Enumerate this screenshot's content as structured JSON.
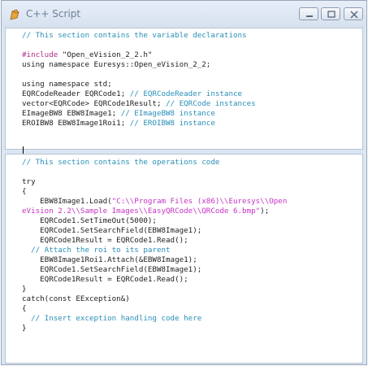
{
  "window": {
    "title": "C++ Script",
    "icon": "cpp-script-icon",
    "controls": [
      "minimize-icon",
      "maximize-icon",
      "close-icon"
    ]
  },
  "colors": {
    "comment": "#2a8fb8",
    "string": "#c534c5",
    "preprocessor": "#b02c8a",
    "text": "#222222"
  },
  "declarations": {
    "lines": [
      [
        {
          "t": "// This section contains the variable declarations",
          "c": "cmt"
        }
      ],
      [],
      [
        {
          "t": "#include ",
          "c": "pp"
        },
        {
          "t": "\"Open_eVision_2_2.h\"",
          "c": ""
        }
      ],
      [
        {
          "t": "using namespace Euresys::Open_eVision_2_2;",
          "c": ""
        }
      ],
      [],
      [
        {
          "t": "using namespace std;",
          "c": ""
        }
      ],
      [
        {
          "t": "EQRCodeReader EQRCode1; ",
          "c": ""
        },
        {
          "t": "// EQRCodeReader instance",
          "c": "cmt"
        }
      ],
      [
        {
          "t": "vector<EQRCode> EQRCode1Result; ",
          "c": ""
        },
        {
          "t": "// EQRCode instances",
          "c": "cmt"
        }
      ],
      [
        {
          "t": "EImageBW8 EBW8Image1; ",
          "c": ""
        },
        {
          "t": "// EImageBW8 instance",
          "c": "cmt"
        }
      ],
      [
        {
          "t": "EROIBW8 EBW8Image1Roi1; ",
          "c": ""
        },
        {
          "t": "// EROIBW8 instance",
          "c": "cmt"
        }
      ]
    ]
  },
  "operations": {
    "lines": [
      [
        {
          "t": "// This section contains the operations code",
          "c": "cmt"
        }
      ],
      [],
      [
        {
          "t": "try",
          "c": ""
        }
      ],
      [
        {
          "t": "{",
          "c": ""
        }
      ],
      [
        {
          "t": "    EBW8Image1.Load(",
          "c": ""
        },
        {
          "t": "\"C:\\\\Program Files (x86)\\\\Euresys\\\\Open",
          "c": "str"
        }
      ],
      [
        {
          "t": "eVision 2.2\\\\Sample Images\\\\EasyQRCode\\\\QRCode 6.bmp\"",
          "c": "str"
        },
        {
          "t": ");",
          "c": ""
        }
      ],
      [
        {
          "t": "    EQRCode1.SetTimeOut(5000);",
          "c": ""
        }
      ],
      [
        {
          "t": "    EQRCode1.SetSearchField(EBW8Image1);",
          "c": ""
        }
      ],
      [
        {
          "t": "    EQRCode1Result = EQRCode1.Read();",
          "c": ""
        }
      ],
      [
        {
          "t": "  // Attach the roi to its parent",
          "c": "cmt"
        }
      ],
      [
        {
          "t": "    EBW8Image1Roi1.Attach(&EBW8Image1);",
          "c": ""
        }
      ],
      [
        {
          "t": "    EQRCode1.SetSearchField(EBW8Image1);",
          "c": ""
        }
      ],
      [
        {
          "t": "    EQRCode1Result = EQRCode1.Read();",
          "c": ""
        }
      ],
      [
        {
          "t": "}",
          "c": ""
        }
      ],
      [
        {
          "t": "catch(const EException&)",
          "c": ""
        }
      ],
      [
        {
          "t": "{",
          "c": ""
        }
      ],
      [
        {
          "t": "  // Insert exception handling code here",
          "c": "cmt"
        }
      ],
      [
        {
          "t": "}",
          "c": ""
        }
      ]
    ]
  }
}
